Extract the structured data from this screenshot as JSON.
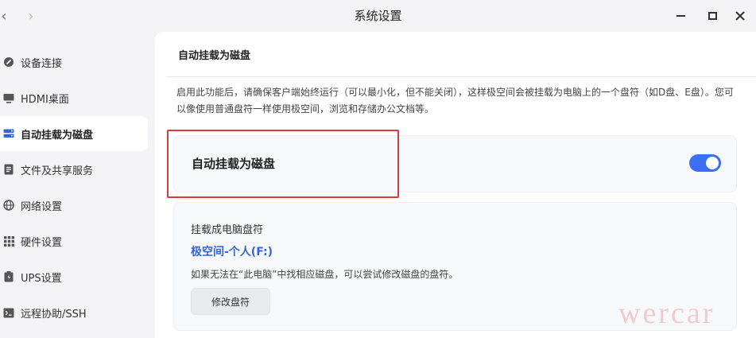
{
  "window": {
    "title": "系统设置",
    "back_icon": "‹",
    "forward_icon": "›"
  },
  "sidebar": {
    "items": [
      {
        "label": "设备连接",
        "icon": "link-icon"
      },
      {
        "label": "HDMI桌面",
        "icon": "monitor-icon"
      },
      {
        "label": "自动挂载为磁盘",
        "icon": "disk-icon",
        "active": true
      },
      {
        "label": "文件及共享服务",
        "icon": "document-icon"
      },
      {
        "label": "网络设置",
        "icon": "globe-icon"
      },
      {
        "label": "硬件设置",
        "icon": "grid-icon"
      },
      {
        "label": "UPS设置",
        "icon": "battery-icon"
      },
      {
        "label": "远程协助/SSH",
        "icon": "terminal-icon"
      }
    ]
  },
  "main": {
    "section_title": "自动挂载为磁盘",
    "description": "启用此功能后，请确保客户端始终运行（可以最小化，但不能关闭），这样极空间会被挂载为电脑上的一个盘符（如D盘、E盘）。您可以像使用普通盘符一样使用极空间，浏览和存储办公文档等。",
    "toggle": {
      "label": "自动挂载为磁盘",
      "enabled": true
    },
    "drive": {
      "heading": "挂载成电脑盘符",
      "value": "极空间-个人(F:)",
      "hint": "如果无法在“此电脑”中找相应磁盘，可以尝试修改磁盘的盘符。",
      "button_label": "修改盘符"
    }
  },
  "watermark": "wercar",
  "colors": {
    "accent": "#3b6ef2",
    "link": "#3166d8",
    "highlight": "#d93a3a"
  }
}
